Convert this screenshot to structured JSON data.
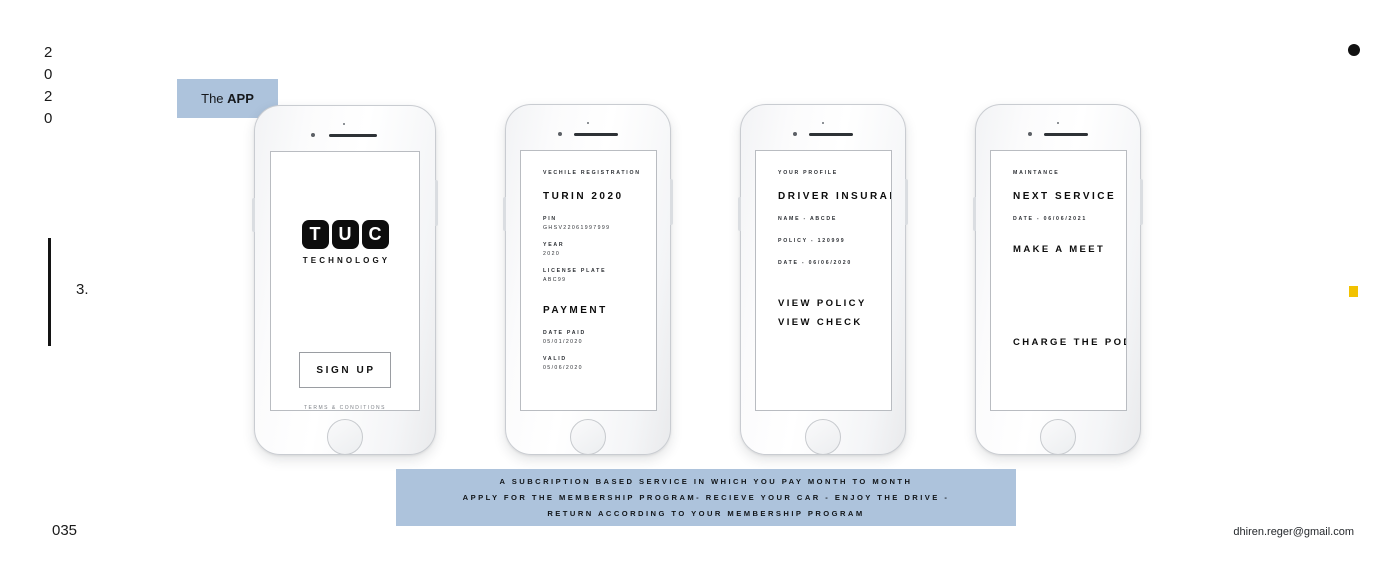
{
  "page": {
    "year_vertical": [
      "2",
      "0",
      "2",
      "0"
    ],
    "section_number": "3.",
    "page_number": "035",
    "email": "dhiren.reger@gmail.com",
    "accent_blue": "#adc3dc",
    "marker_yellow": "#f2c200",
    "marker_black": "#111111"
  },
  "app_tag": {
    "prefix": "The ",
    "emphasis": "APP"
  },
  "phones": [
    {
      "id": "phone-signup",
      "logo": {
        "tiles": [
          "T",
          "U",
          "C"
        ],
        "subtitle": "TECHNOLOGY"
      },
      "signup_label": "SIGN UP",
      "terms_label": "TERMS & CONDITIONS"
    },
    {
      "id": "phone-registration",
      "eyebrow": "VECHILE REGISTRATION",
      "title": "TURIN 2020",
      "fields": [
        {
          "label": "PIN",
          "value": "GHSV22061997999"
        },
        {
          "label": "YEAR",
          "value": "2020"
        },
        {
          "label": "LICENSE PLATE",
          "value": "ABC99"
        }
      ],
      "section_title": "PAYMENT",
      "payment_fields": [
        {
          "label": "DATE PAID",
          "value": "05/01/2020"
        },
        {
          "label": "VALID",
          "value": "05/06/2020"
        }
      ]
    },
    {
      "id": "phone-insurance",
      "eyebrow": "YOUR PROFILE",
      "title": "DRIVER INSURANCE",
      "rows": [
        "NAME - ABCDE",
        "POLICY - 120999",
        "DATE - 06/06/2020"
      ],
      "actions": [
        "VIEW POLICY",
        "VIEW CHECK"
      ]
    },
    {
      "id": "phone-maintenance",
      "eyebrow": "MAINTANCE",
      "title": "NEXT SERVICE",
      "rows": [
        "DATE - 06/06/2021"
      ],
      "actions": [
        "MAKE A MEET"
      ],
      "footer_action": "CHARGE THE POD"
    }
  ],
  "caption": {
    "lines": [
      "A SUBCRIPTION BASED SERVICE IN WHICH YOU PAY MONTH TO MONTH",
      "APPLY FOR THE MEMBERSHIP PROGRAM- RECIEVE YOUR CAR - ENJOY THE DRIVE -",
      "RETURN ACCORDING TO YOUR MEMBERSHIP PROGRAM"
    ]
  }
}
